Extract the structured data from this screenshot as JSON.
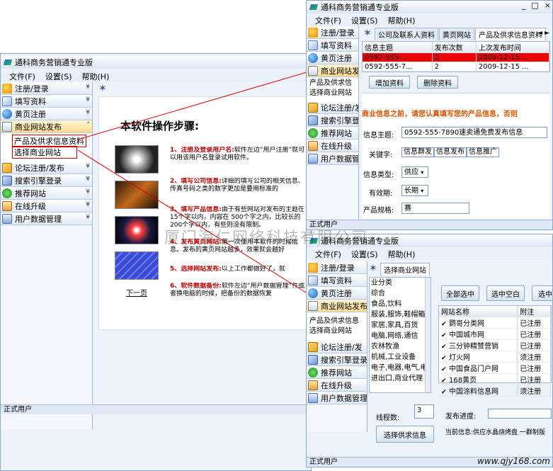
{
  "main": {
    "title": "通科商务营销通专业版",
    "window_buttons": [
      "_",
      "□",
      "×"
    ],
    "menu": [
      "文件(F)",
      "设置(S)",
      "帮助(H)"
    ],
    "nav": [
      {
        "label": "注册/登录",
        "icon": "user-icon"
      },
      {
        "label": "填写资料",
        "icon": "edit-icon"
      },
      {
        "label": "黄页注册",
        "icon": "globe-icon"
      },
      {
        "label": "商业网站发布",
        "icon": "business-icon"
      },
      {
        "label": "论坛注册/发布",
        "icon": "forum-icon"
      },
      {
        "label": "搜索引擎登录",
        "icon": "search-engine-icon"
      },
      {
        "label": "推荐网站",
        "icon": "check-icon"
      },
      {
        "label": "在线升级",
        "icon": "upgrade-icon"
      },
      {
        "label": "用户数据管理",
        "icon": "data-icon"
      }
    ],
    "nav_sub": [
      "产品及供求信息资料",
      "选择商业网站"
    ],
    "status": "正式用户",
    "content_title": "本软件操作步骤:",
    "steps": [
      {
        "name": "1、注册及登录用户名:",
        "text": "软件左边“用户注册”就可以用该用户名登录试用软件。"
      },
      {
        "name": "2、填写公司信息:",
        "text": "详细的填写公司的相关信息、传真号码之类的数字更加是要用标准的"
      },
      {
        "name": "3、填写产品信息:",
        "text": "由于有些网站对发布的主题在 15个字以内，内容在 500个字之内，比较长的 200个字以内，有些则没有限制。"
      },
      {
        "name": "4、发布黄页网站:",
        "text": "第一次使用本软件的时候信息。发布的黄页网站越多，效果就会越好"
      },
      {
        "name": "5、选择网站发布:",
        "text": "以上工作都做好了，就"
      },
      {
        "name": "6、软件数据备份:",
        "text": "软件左边“用户数据管理”件或者换电脑的时候，把备份的数据恢复"
      }
    ],
    "next_page": "下一页"
  },
  "win2": {
    "title": "通科商务营销通专业版",
    "menu": [
      "文件(F)",
      "设置(S)",
      "帮助(H)"
    ],
    "nav_short": [
      "注册/登录",
      "填写资料",
      "黄页注册",
      "商业网站发布",
      "论坛注册/发布",
      "搜索引擎登",
      "推荐网站",
      "在线升级",
      "用户数据管理"
    ],
    "sub": [
      "产品及供求信",
      "选择商业网站"
    ],
    "tabs": [
      "公司及联系人资料",
      "黄页网站",
      "产品及供求信息资料"
    ],
    "table_headers": [
      "信息主题",
      "发布次数",
      "上次发布时间"
    ],
    "rows": [
      {
        "subject": "0592-555-...",
        "count": "2",
        "time": "2009-12-15 ..."
      },
      {
        "subject": "0592-555-7...",
        "count": "2",
        "time": "2009-12-15 ..."
      }
    ],
    "add_button": "增加资料",
    "delete_button": "删除资料",
    "notice": "商业信息之前，请您认真填写您的产品信息，否则",
    "subject_label": "信息主题:",
    "subject_value": "0592-555-7890速卖通免费发布信息",
    "keyword_label": "关键字:",
    "keywords": [
      "信息群发",
      "信息发布",
      "信息推广"
    ],
    "type_label": "信息类型:",
    "type_value": "供应",
    "validity_label": "有效期:",
    "validity_value": "长期",
    "spec_label": "产品规格:",
    "spec_value": "赛",
    "status": "正式用户"
  },
  "win3": {
    "title": "通科商务营销通专业版",
    "menu": [
      "文件(F)",
      "设置(S)",
      "帮助(H)"
    ],
    "nav_short": [
      "注册/登录",
      "填写资料",
      "黄页注册",
      "商业网站发布",
      "论坛注册/发",
      "搜索引擎登录",
      "推荐网站",
      "在线升级",
      "用户数据管理"
    ],
    "sub": [
      "产品及供求信息",
      "选择商业网站"
    ],
    "tab": "选择商业网站",
    "categories": [
      "业分类",
      "综合",
      "食品,饮料",
      "服装,服饰,鞋帽箱",
      "家居,家具,百货",
      "电脑,网络,通信",
      "农林牧渔",
      "机械,工业设备",
      "电子,电器,电气,电",
      "进出口,商业代理"
    ],
    "select_all_button": "全部选中",
    "select_blank_button": "选中空白",
    "select_button_partial": "选中",
    "site_headers": [
      "网站名称",
      "附注"
    ],
    "sites": [
      {
        "name": "鹦哥分类网",
        "note": "已注册"
      },
      {
        "name": "中国城市网",
        "note": "已注册"
      },
      {
        "name": "三分钟精赞营销",
        "note": "已注册"
      },
      {
        "name": "灯火网",
        "note": "须注册"
      },
      {
        "name": "中国食品门户网",
        "note": "已注册"
      },
      {
        "name": "168黄页",
        "note": "已注册"
      },
      {
        "name": "中国涂料信息网",
        "note": "须注册"
      }
    ],
    "threads_label": "线程数:",
    "threads_value": "3",
    "progress_label": "发布进度:",
    "select_info_button": "选择供求信息",
    "current_info": "当前信息:供应水晶烧烤盘 一群制版",
    "status": "正式用户"
  },
  "watermark": "厦门海仁网络科技有限公司",
  "footer_url": "www.qjy168.com"
}
